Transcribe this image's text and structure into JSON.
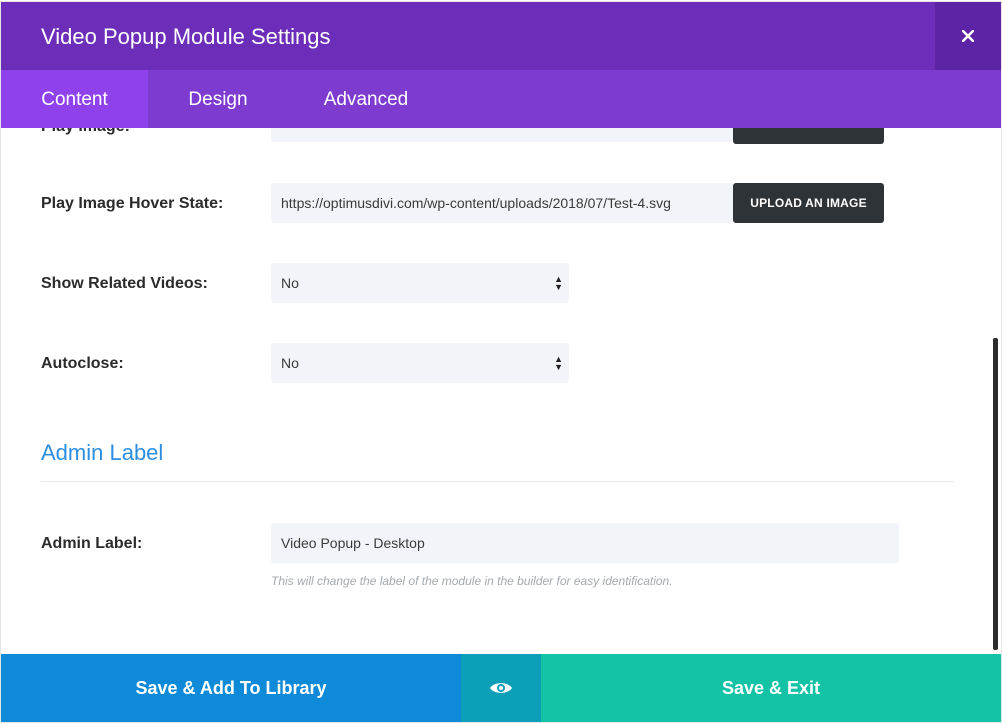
{
  "header": {
    "title": "Video Popup Module Settings",
    "close_icon": "close-icon"
  },
  "tabs": [
    {
      "label": "Content",
      "active": true
    },
    {
      "label": "Design",
      "active": false
    },
    {
      "label": "Advanced",
      "active": false
    }
  ],
  "fields": {
    "play_image": {
      "label": "Play Image:"
    },
    "play_image_hover": {
      "label": "Play Image Hover State:",
      "value": "https://optimusdivi.com/wp-content/uploads/2018/07/Test-4.svg",
      "button": "UPLOAD AN IMAGE"
    },
    "show_related": {
      "label": "Show Related Videos:",
      "value": "No"
    },
    "autoclose": {
      "label": "Autoclose:",
      "value": "No"
    }
  },
  "admin_section": {
    "title": "Admin Label",
    "label": "Admin Label:",
    "value": "Video Popup - Desktop",
    "help": "This will change the label of the module in the builder for easy identification."
  },
  "footer": {
    "save_library": "Save & Add To Library",
    "preview_icon": "eye-icon",
    "save_exit": "Save & Exit"
  },
  "colors": {
    "header": "#6c2eb9",
    "tabs": "#7e3bd0",
    "active_tab": "#8f42ec",
    "link": "#2d8ee0",
    "save_library": "#0f8ad8",
    "preview": "#0e9fb8",
    "save_exit": "#14c3a6"
  }
}
